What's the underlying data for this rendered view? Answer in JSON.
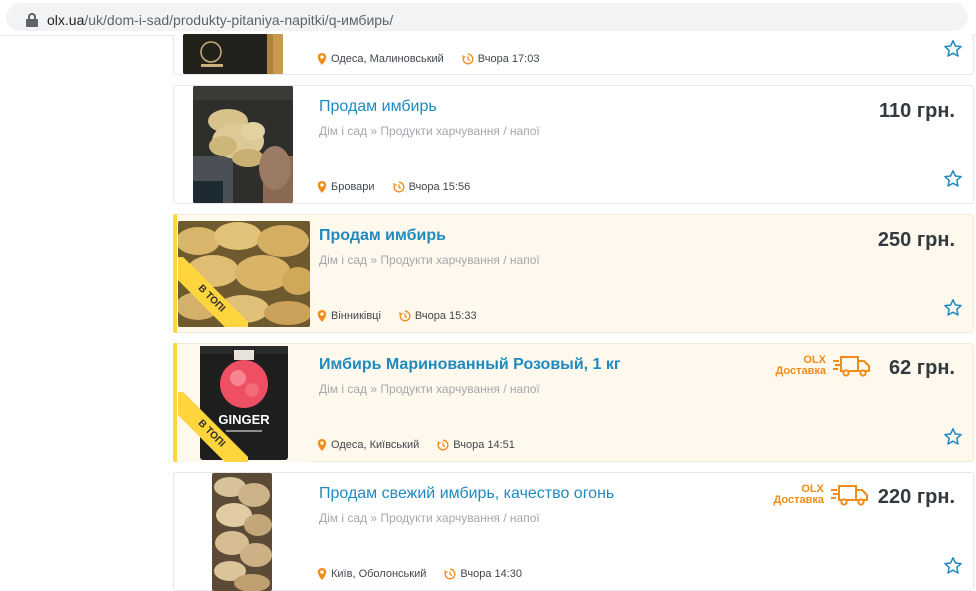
{
  "browser": {
    "url_host": "olx.ua",
    "url_path": "/uk/dom-i-sad/produkty-pitaniya-napitki/q-имбирь/"
  },
  "colors": {
    "title_link": "#1f8ac0",
    "delivery_orange": "#f08c18",
    "top_badge_yellow": "#ffd53e",
    "top_background": "#fff8ed"
  },
  "listings": [
    {
      "title": "",
      "breadcrumb": "",
      "price": "",
      "location": "Одеса, Малиновський",
      "time": "Вчора 17:03",
      "is_top": false,
      "delivery": false
    },
    {
      "title": "Продам имбирь",
      "breadcrumb": "Дім і сад » Продукти харчування / напої",
      "price": "110 грн.",
      "location": "Бровари",
      "time": "Вчора 15:56",
      "is_top": false,
      "delivery": false
    },
    {
      "title": "Продам имбирь",
      "breadcrumb": "Дім і сад » Продукти харчування / напої",
      "price": "250 грн.",
      "location": "Вінниківці",
      "time": "Вчора 15:33",
      "is_top": true,
      "top_badge": "В ТОПІ",
      "delivery": false
    },
    {
      "title": "Имбирь Маринованный Розовый, 1 кг",
      "breadcrumb": "Дім і сад » Продукти харчування / напої",
      "price": "62 грн.",
      "location": "Одеса, Київський",
      "time": "Вчора 14:51",
      "is_top": true,
      "top_badge": "В ТОПІ",
      "delivery": true,
      "delivery_brand": "OLX",
      "delivery_label": "Доставка",
      "image_text": "GINGER"
    },
    {
      "title": "Продам свежий имбирь, качество огонь",
      "breadcrumb": "Дім і сад » Продукти харчування / напої",
      "price": "220 грн.",
      "location": "Київ, Оболонський",
      "time": "Вчора 14:30",
      "is_top": false,
      "delivery": true,
      "delivery_brand": "OLX",
      "delivery_label": "Доставка"
    }
  ],
  "icons": {
    "lock": "lock-icon",
    "location": "map-pin-icon",
    "time": "history-clock-icon",
    "favorite": "star-outline-icon",
    "delivery": "delivery-truck-icon"
  }
}
